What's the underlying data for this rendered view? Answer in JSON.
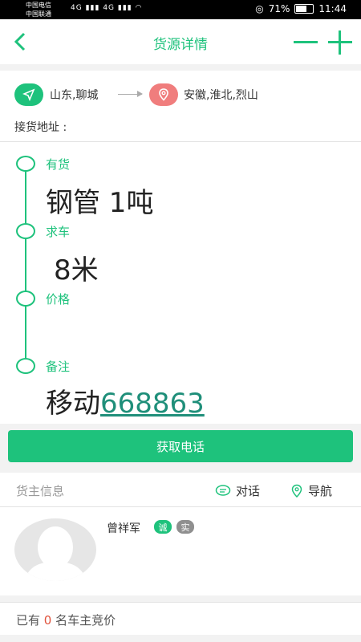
{
  "status_bar": {
    "carrier1": "中国电信",
    "carrier2": "中国联通",
    "network_left": "4G",
    "network_right": "4G",
    "battery": "71%",
    "battery_level": 0.71,
    "time": "11:44"
  },
  "header": {
    "title": "货源详情",
    "back_icon": "chevron-left-icon",
    "minus_icon": "minus-icon",
    "plus_icon": "plus-icon",
    "accent": "#1ec27c"
  },
  "route": {
    "from": "山东,聊城",
    "to": "安徽,淮北,烈山",
    "pickup_label": "接货地址 :"
  },
  "cargo": {
    "goods_label": "有货",
    "goods_value": "钢管 1吨",
    "truck_label": "求车",
    "truck_value": "8米",
    "price_label": "价格",
    "price_value": "",
    "note_label": "备注",
    "note_prefix": "移动",
    "note_phone": "668863"
  },
  "actions": {
    "get_phone": "获取电话"
  },
  "owner": {
    "section_title": "货主信息",
    "chat": "对话",
    "navigate": "导航",
    "name": "曾祥军",
    "badge_honest": "诚",
    "badge_real": "实"
  },
  "bids": {
    "prefix": "已有",
    "count": "0",
    "suffix": "名车主竞价"
  }
}
